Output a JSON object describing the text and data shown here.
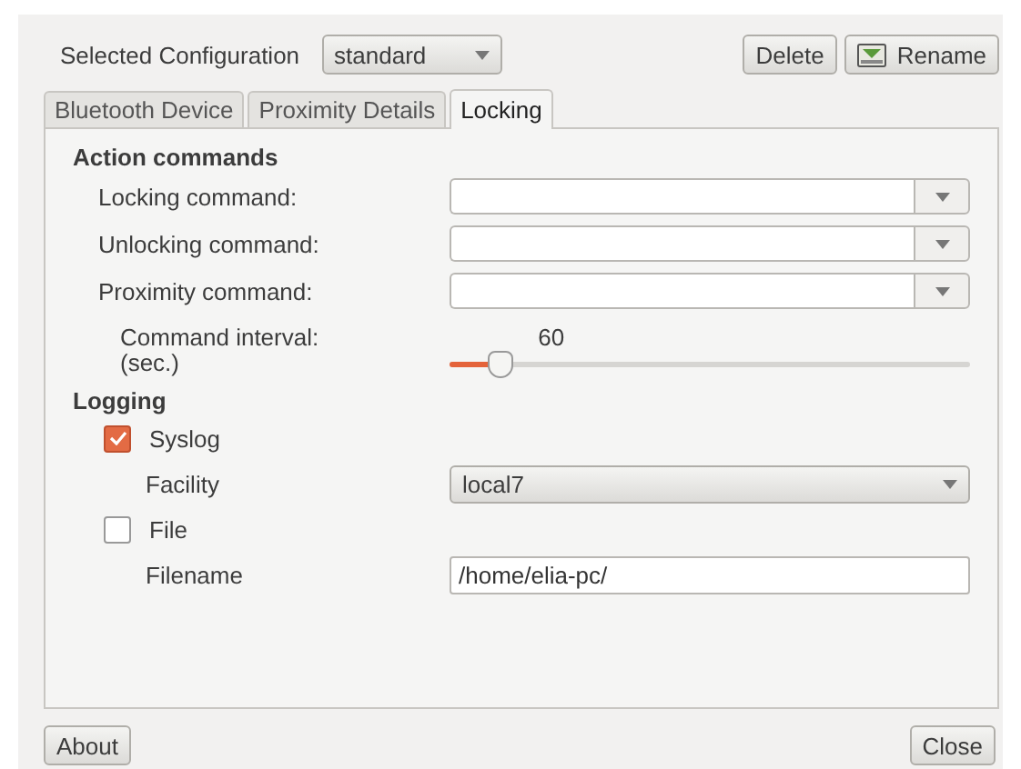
{
  "header": {
    "label": "Selected Configuration",
    "configuration": "standard",
    "buttons": [
      {
        "label": "Delete",
        "kind": "plain"
      },
      {
        "label": "Rename",
        "kind": "icon"
      }
    ]
  },
  "tabs": [
    {
      "label": "Bluetooth Device",
      "selected": false
    },
    {
      "label": "Proximity Details",
      "selected": false
    },
    {
      "label": "Locking",
      "selected": true
    }
  ],
  "action_commands": {
    "title": "Action commands",
    "commands": [
      {
        "label": "Locking command:"
      },
      {
        "label": "Unlocking command:"
      },
      {
        "label": "Proximity command:"
      }
    ],
    "interval": {
      "label": "Command interval:\n(sec.)",
      "reading": "60",
      "level": 0.1
    }
  },
  "logging": {
    "title": "Logging",
    "syslog": {
      "label": "Syslog",
      "checked": true
    },
    "facility": {
      "label": "Facility",
      "value": "local7"
    },
    "file": {
      "label": "File",
      "checked": false
    },
    "filename": {
      "label": "Filename",
      "value": "/home/elia-pc/"
    }
  },
  "footer": {
    "about": "About",
    "close": "Close"
  }
}
